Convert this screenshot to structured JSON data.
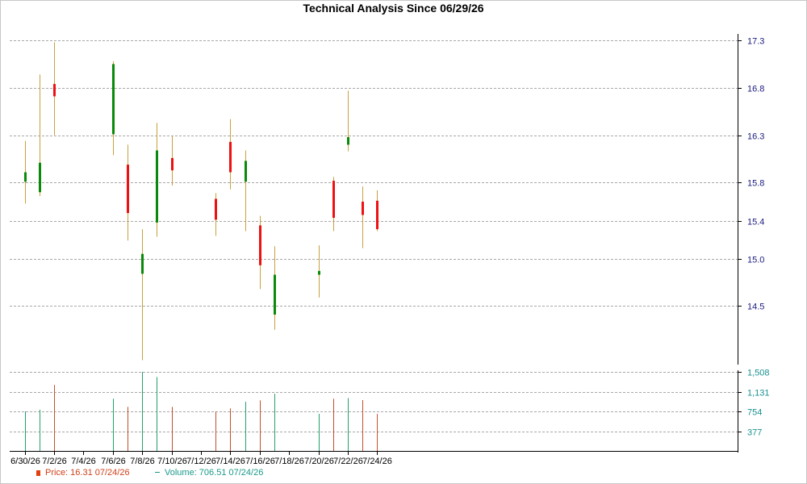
{
  "chart_data": {
    "type": "candlestick",
    "title": "Technical Analysis Since 06/29/26",
    "price_axis": {
      "ticks": [
        14.5,
        15.0,
        15.4,
        15.8,
        16.3,
        16.8,
        17.3
      ],
      "ylim": [
        13.9,
        17.3
      ]
    },
    "volume_axis": {
      "ticks": [
        377,
        754,
        1131,
        1508
      ],
      "tick_labels": [
        "377",
        "754",
        "1,131",
        "1,508"
      ],
      "ylim": [
        0,
        1508
      ]
    },
    "x_tick_labels": [
      "6/30/26",
      "7/2/26",
      "7/4/26",
      "7/6/26",
      "7/8/26",
      "7/10/26",
      "7/12/26",
      "7/14/26",
      "7/16/26",
      "7/18/26",
      "7/20/26",
      "7/22/26",
      "7/24/26"
    ],
    "grid": true,
    "candles": [
      {
        "date": "6/30/26",
        "open": 15.81,
        "close": 15.91,
        "high": 16.24,
        "low": 15.58,
        "volume": 754,
        "direction": "up"
      },
      {
        "date": "7/1/26",
        "open": 15.7,
        "close": 16.01,
        "high": 16.94,
        "low": 15.66,
        "volume": 787,
        "direction": "up"
      },
      {
        "date": "7/2/26",
        "open": 16.71,
        "close": 16.84,
        "high": 17.28,
        "low": 16.3,
        "volume": 1260,
        "direction": "down"
      },
      {
        "date": "7/6/26",
        "open": 17.05,
        "close": 16.31,
        "high": 17.08,
        "low": 16.09,
        "volume": 996,
        "direction": "up"
      },
      {
        "date": "7/7/26",
        "open": 15.99,
        "close": 15.48,
        "high": 16.2,
        "low": 15.19,
        "volume": 840,
        "direction": "down"
      },
      {
        "date": "7/8/26",
        "open": 15.05,
        "close": 14.84,
        "high": 15.31,
        "low": 13.93,
        "volume": 1508,
        "direction": "up"
      },
      {
        "date": "7/9/26",
        "open": 15.38,
        "close": 16.14,
        "high": 16.43,
        "low": 15.23,
        "volume": 1410,
        "direction": "up"
      },
      {
        "date": "7/10/26",
        "open": 16.06,
        "close": 15.93,
        "high": 16.29,
        "low": 15.77,
        "volume": 840,
        "direction": "down"
      },
      {
        "date": "7/13/26",
        "open": 15.63,
        "close": 15.41,
        "high": 15.69,
        "low": 15.24,
        "volume": 754,
        "direction": "down"
      },
      {
        "date": "7/14/26",
        "open": 16.23,
        "close": 15.91,
        "high": 16.47,
        "low": 15.73,
        "volume": 812,
        "direction": "down"
      },
      {
        "date": "7/15/26",
        "open": 16.03,
        "close": 15.81,
        "high": 16.14,
        "low": 15.29,
        "volume": 936,
        "direction": "up"
      },
      {
        "date": "7/16/26",
        "open": 15.35,
        "close": 14.93,
        "high": 15.45,
        "low": 14.68,
        "volume": 963,
        "direction": "down"
      },
      {
        "date": "7/17/26",
        "open": 14.41,
        "close": 14.83,
        "high": 15.13,
        "low": 14.25,
        "volume": 1091,
        "direction": "up"
      },
      {
        "date": "7/20/26",
        "open": 14.83,
        "close": 14.87,
        "high": 15.14,
        "low": 14.59,
        "volume": 708,
        "direction": "up"
      },
      {
        "date": "7/21/26",
        "open": 15.43,
        "close": 15.82,
        "high": 15.86,
        "low": 15.29,
        "volume": 996,
        "direction": "down"
      },
      {
        "date": "7/22/26",
        "open": 16.2,
        "close": 16.28,
        "high": 16.77,
        "low": 16.13,
        "volume": 1007,
        "direction": "up"
      },
      {
        "date": "7/23/26",
        "open": 15.6,
        "close": 15.46,
        "high": 15.76,
        "low": 15.11,
        "volume": 969,
        "direction": "down"
      },
      {
        "date": "7/24/26",
        "open": 15.61,
        "close": 15.31,
        "high": 15.72,
        "low": 15.29,
        "volume": 706.51,
        "direction": "down"
      }
    ],
    "legend": {
      "price_text": "Price: 16.31  07/24/26",
      "volume_text": "Volume: 706.51  07/24/26"
    },
    "colors": {
      "up_body": "#0a8a0a",
      "down_body": "#ee1111",
      "wick": "#c8a040",
      "vol_up": "#22a06a",
      "vol_down": "#c4502a",
      "grid": "#a8a8a8",
      "axis": "#000000"
    }
  }
}
